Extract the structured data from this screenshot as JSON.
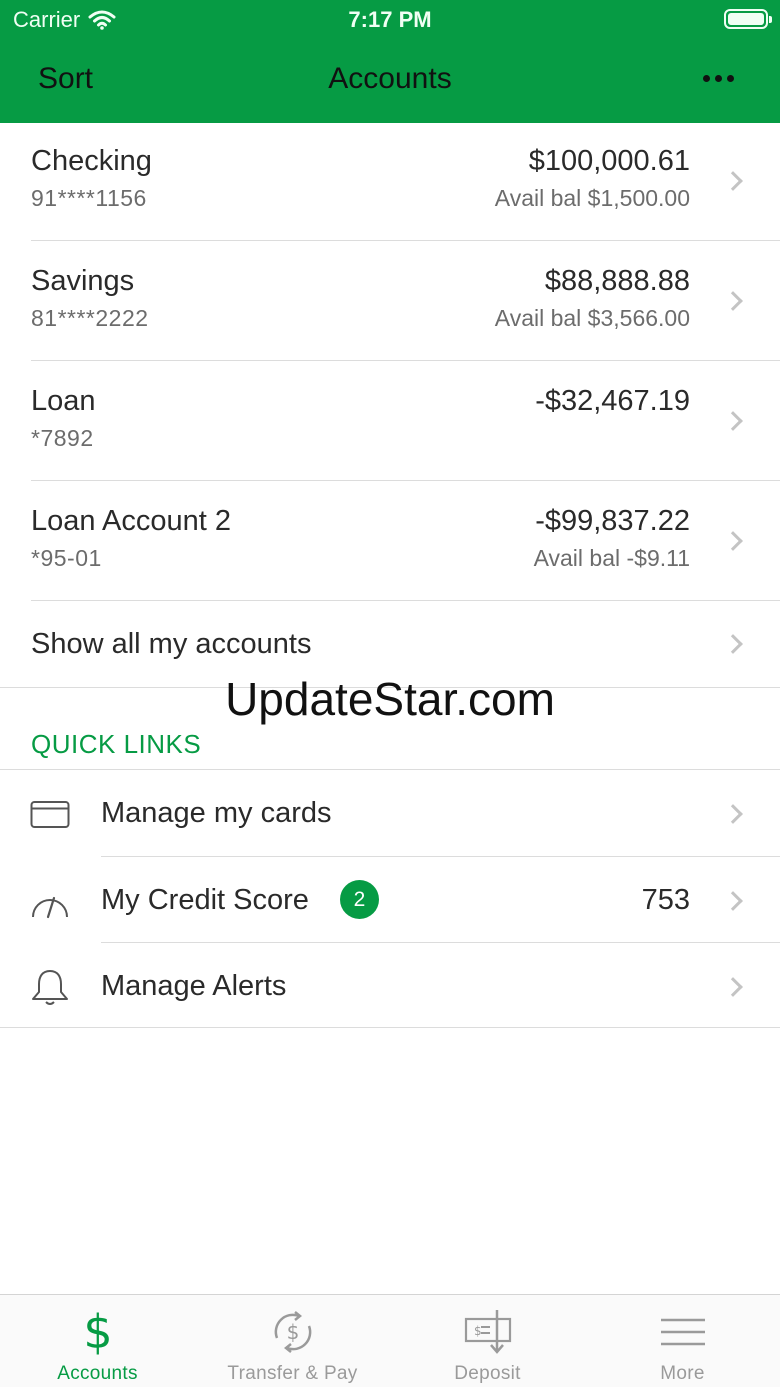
{
  "status_bar": {
    "carrier": "Carrier",
    "time": "7:17 PM"
  },
  "nav": {
    "sort_label": "Sort",
    "title": "Accounts"
  },
  "accounts": [
    {
      "name": "Checking",
      "number": "91****1156",
      "balance": "$100,000.61",
      "available": "Avail bal $1,500.00"
    },
    {
      "name": "Savings",
      "number": "81****2222",
      "balance": "$88,888.88",
      "available": "Avail bal $3,566.00"
    },
    {
      "name": "Loan",
      "number": "*7892",
      "balance": "-$32,467.19",
      "available": ""
    },
    {
      "name": "Loan Account 2",
      "number": "*95-01",
      "balance": "-$99,837.22",
      "available": "Avail bal -$9.11"
    }
  ],
  "show_all_label": "Show all my accounts",
  "watermark": "UpdateStar.com",
  "quick_links": {
    "header": "QUICK LINKS",
    "items": [
      {
        "label": "Manage my cards",
        "icon": "card-icon"
      },
      {
        "label": "My Credit Score",
        "icon": "gauge-icon",
        "badge": "2",
        "value": "753"
      },
      {
        "label": "Manage Alerts",
        "icon": "bell-icon"
      }
    ]
  },
  "tabbar": {
    "items": [
      {
        "label": "Accounts",
        "icon": "dollar-icon",
        "active": true
      },
      {
        "label": "Transfer & Pay",
        "icon": "transfer-icon",
        "active": false
      },
      {
        "label": "Deposit",
        "icon": "deposit-check-icon",
        "active": false
      },
      {
        "label": "More",
        "icon": "menu-icon",
        "active": false
      }
    ]
  },
  "colors": {
    "brand_green": "#069b44",
    "text_primary": "#2a2a2a",
    "text_secondary": "#6c6c6c",
    "tab_inactive": "#9a9a9a"
  }
}
